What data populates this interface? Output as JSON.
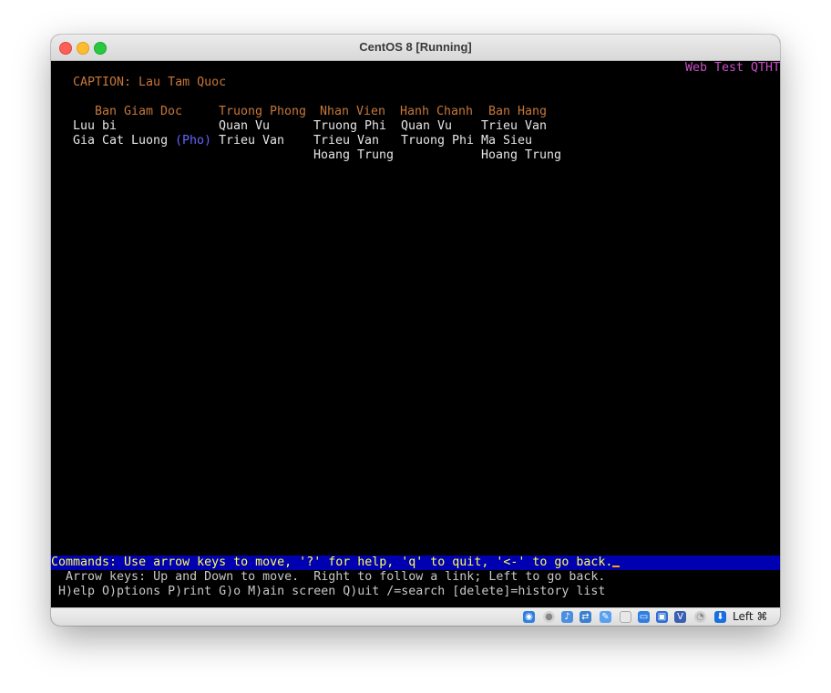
{
  "window": {
    "title": "CentOS 8 [Running]"
  },
  "terminal": {
    "top_right_text": "Web Test QTHT",
    "caption": "CAPTION: Lau Tam Quoc",
    "headers": [
      "Ban Giam Doc",
      "Truong Phong",
      "Nhan Vien",
      "Hanh Chanh",
      "Ban Hang"
    ],
    "col_ban_giam_doc": [
      "Luu bi",
      "Gia Cat Luong"
    ],
    "pho_link": "(Pho)",
    "col_truong_phong": [
      "Quan Vu",
      "Trieu Van"
    ],
    "col_nhan_vien": [
      "Truong Phi",
      "Trieu Van",
      "Hoang Trung"
    ],
    "col_hanh_chanh": [
      "Quan Vu",
      "Truong Phi"
    ],
    "col_ban_hang": [
      "Trieu Van",
      "Ma Sieu",
      "Hoang Trung"
    ],
    "command_line": "Commands: Use arrow keys to move, '?' for help, 'q' to quit, '<-' to go back.",
    "help_line_1": "  Arrow keys: Up and Down to move.  Right to follow a link; Left to go back.",
    "help_line_2": " H)elp O)ptions P)rint G)o M)ain screen Q)uit /=search [delete]=history list"
  },
  "statusbar": {
    "host_key": "Left ⌘",
    "icons": [
      "hard-disk-icon",
      "optical-drive-icon",
      "audio-icon",
      "network-icon",
      "usb-icon",
      "shared-folder-icon",
      "display-icon",
      "recording-icon",
      "virtualization-icon",
      "cpu-icon",
      "mouse-integration-icon"
    ]
  },
  "colors": {
    "terminal_bg": "#000000",
    "orange_text": "#c7773a",
    "white_text": "#e6e6e6",
    "magenta_text": "#c64ec6",
    "link_blue": "#6464ff",
    "command_bar_bg": "#0000b0",
    "command_text": "#ffff55"
  }
}
